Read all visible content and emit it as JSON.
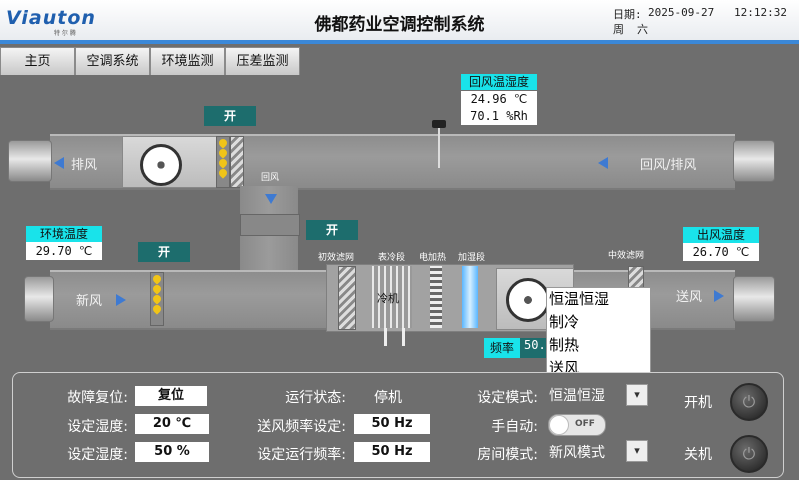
{
  "header": {
    "logo": "Viauton",
    "logo_sub": "特 尔 腾",
    "title": "佛都药业空调控制系统",
    "date_label": "日期:",
    "date": "2025-09-27",
    "time": "12:12:32",
    "weekday_label": "周",
    "weekday": "六"
  },
  "nav": {
    "tabs": [
      {
        "label": "主页"
      },
      {
        "label": "空调系统"
      },
      {
        "label": "环境监测"
      },
      {
        "label": "压差监测"
      }
    ]
  },
  "diagram": {
    "exhaust_label": "排风",
    "return_exhaust_label": "回风/排风",
    "return_air_label": "回风",
    "fresh_air_label": "新风",
    "supply_air_label": "送风",
    "open_label": "开",
    "primary_filter": "初效滤网",
    "cooling_section": "表冷段",
    "electric_heating": "电加热",
    "humidifying": "加湿段",
    "medium_filter": "中效滤网",
    "coil_text": "冷机",
    "return_sensor": {
      "title": "回风温湿度",
      "temp": "24.96 ℃",
      "humidity": "70.1 %Rh"
    },
    "env_temp": {
      "title": "环境温度",
      "value": "29.70 ℃"
    },
    "supply_temp": {
      "title": "出风温度",
      "value": "26.70 ℃"
    },
    "freq": {
      "label": "频率",
      "value": "50.0"
    }
  },
  "mode_popup": {
    "items": [
      "恒温恒湿",
      "制冷",
      "制热",
      "送风"
    ]
  },
  "panel": {
    "fault_reset_label": "故障复位:",
    "fault_reset_button": "复位",
    "set_humidity_label_1": "设定湿度:",
    "set_humidity_value_1": "20 ℃",
    "set_humidity_label_2": "设定湿度:",
    "set_humidity_value_2": "50 %",
    "run_status_label": "运行状态:",
    "run_status_value": "停机",
    "supply_freq_label": "送风频率设定:",
    "supply_freq_value": "50 Hz",
    "run_freq_label": "设定运行频率:",
    "run_freq_value": "50 Hz",
    "set_mode_label": "设定模式:",
    "set_mode_value": "恒温恒湿",
    "manual_auto_label": "手自动:",
    "toggle_state": "OFF",
    "room_mode_label": "房间模式:",
    "room_mode_value": "新风模式",
    "start_label": "开机",
    "stop_label": "关机",
    "dropdown_icon": "▾"
  },
  "colors": {
    "accent": "#3b88d8",
    "cyan": "#19e3ea",
    "teal": "#1d6d6d",
    "background": "#6e6e6e"
  }
}
